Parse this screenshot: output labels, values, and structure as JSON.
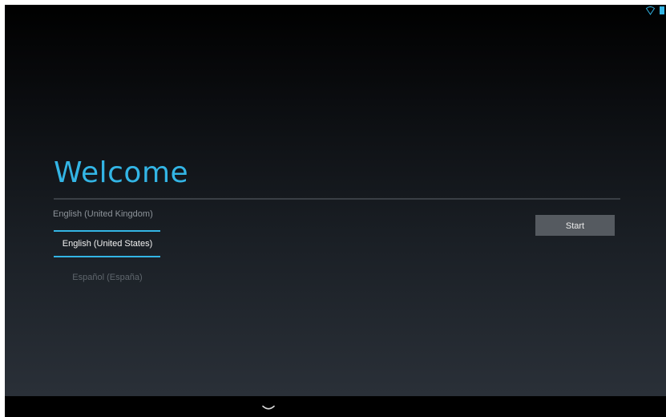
{
  "status_bar": {
    "icons": [
      "wifi-icon",
      "battery-icon"
    ],
    "accent_color": "#33b5e5"
  },
  "welcome": {
    "title": "Welcome",
    "title_color": "#33b5e5"
  },
  "language_picker": {
    "previous": "English (United Kingdom)",
    "selected": "English (United States)",
    "next": "Español (España)"
  },
  "start_button": {
    "label": "Start"
  },
  "nav_bar": {
    "icons": [
      "back-chevron-icon"
    ]
  }
}
